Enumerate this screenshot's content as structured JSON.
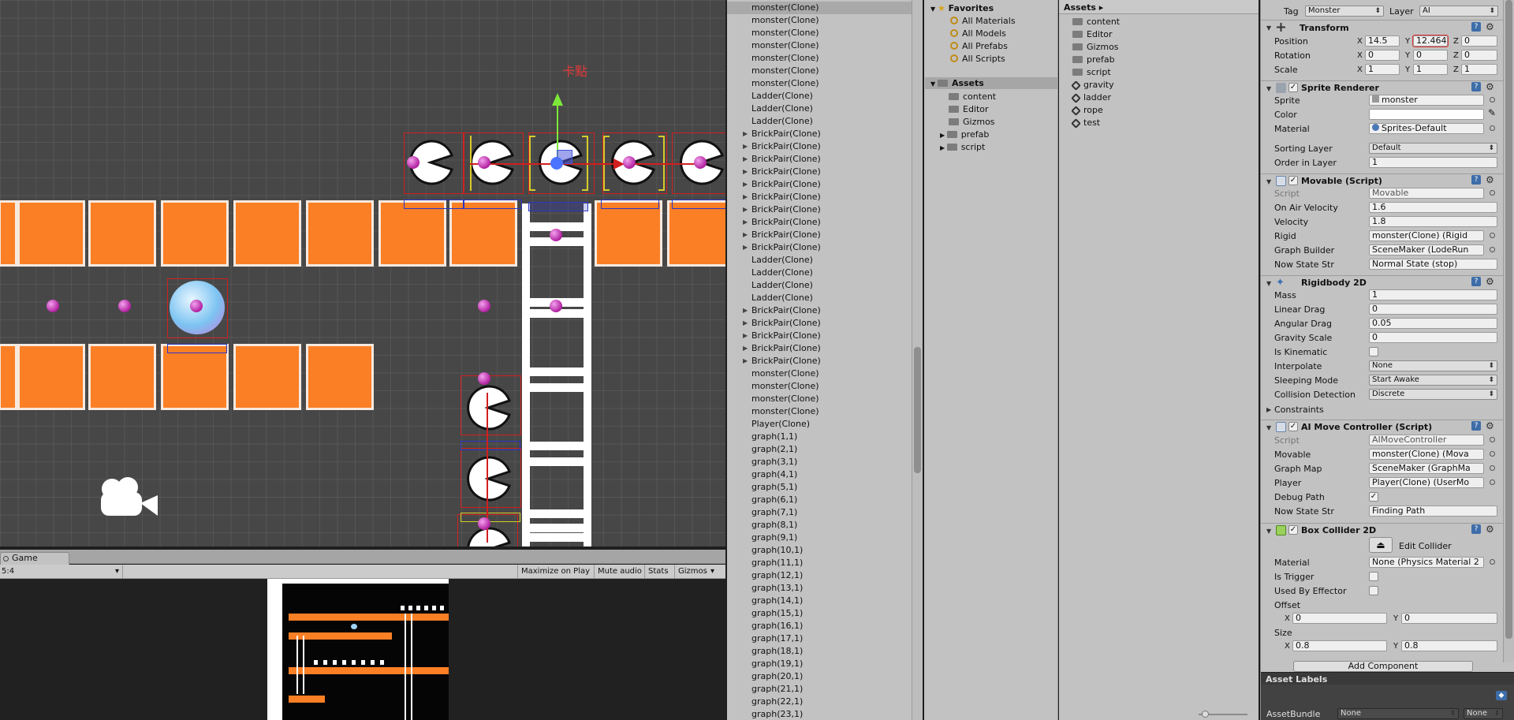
{
  "scene": {
    "label": "卡點"
  },
  "game": {
    "tab": "Game",
    "aspect": "5:4",
    "buttons": [
      "Maximize on Play",
      "Mute audio",
      "Stats",
      "Gizmos"
    ]
  },
  "hierarchy": {
    "items": [
      {
        "label": "monster(Clone)",
        "expandable": false,
        "selected": true
      },
      {
        "label": "monster(Clone)",
        "expandable": false
      },
      {
        "label": "monster(Clone)",
        "expandable": false
      },
      {
        "label": "monster(Clone)",
        "expandable": false
      },
      {
        "label": "monster(Clone)",
        "expandable": false
      },
      {
        "label": "monster(Clone)",
        "expandable": false
      },
      {
        "label": "monster(Clone)",
        "expandable": false
      },
      {
        "label": "Ladder(Clone)",
        "expandable": false
      },
      {
        "label": "Ladder(Clone)",
        "expandable": false
      },
      {
        "label": "Ladder(Clone)",
        "expandable": false
      },
      {
        "label": "BrickPair(Clone)",
        "expandable": true
      },
      {
        "label": "BrickPair(Clone)",
        "expandable": true
      },
      {
        "label": "BrickPair(Clone)",
        "expandable": true
      },
      {
        "label": "BrickPair(Clone)",
        "expandable": true
      },
      {
        "label": "BrickPair(Clone)",
        "expandable": true
      },
      {
        "label": "BrickPair(Clone)",
        "expandable": true
      },
      {
        "label": "BrickPair(Clone)",
        "expandable": true
      },
      {
        "label": "BrickPair(Clone)",
        "expandable": true
      },
      {
        "label": "BrickPair(Clone)",
        "expandable": true
      },
      {
        "label": "BrickPair(Clone)",
        "expandable": true
      },
      {
        "label": "Ladder(Clone)",
        "expandable": false
      },
      {
        "label": "Ladder(Clone)",
        "expandable": false
      },
      {
        "label": "Ladder(Clone)",
        "expandable": false
      },
      {
        "label": "Ladder(Clone)",
        "expandable": false
      },
      {
        "label": "BrickPair(Clone)",
        "expandable": true
      },
      {
        "label": "BrickPair(Clone)",
        "expandable": true
      },
      {
        "label": "BrickPair(Clone)",
        "expandable": true
      },
      {
        "label": "BrickPair(Clone)",
        "expandable": true
      },
      {
        "label": "BrickPair(Clone)",
        "expandable": true
      },
      {
        "label": "monster(Clone)",
        "expandable": false
      },
      {
        "label": "monster(Clone)",
        "expandable": false
      },
      {
        "label": "monster(Clone)",
        "expandable": false
      },
      {
        "label": "monster(Clone)",
        "expandable": false
      },
      {
        "label": "Player(Clone)",
        "expandable": false
      },
      {
        "label": "graph(1,1)",
        "expandable": false
      },
      {
        "label": "graph(2,1)",
        "expandable": false
      },
      {
        "label": "graph(3,1)",
        "expandable": false
      },
      {
        "label": "graph(4,1)",
        "expandable": false
      },
      {
        "label": "graph(5,1)",
        "expandable": false
      },
      {
        "label": "graph(6,1)",
        "expandable": false
      },
      {
        "label": "graph(7,1)",
        "expandable": false
      },
      {
        "label": "graph(8,1)",
        "expandable": false
      },
      {
        "label": "graph(9,1)",
        "expandable": false
      },
      {
        "label": "graph(10,1)",
        "expandable": false
      },
      {
        "label": "graph(11,1)",
        "expandable": false
      },
      {
        "label": "graph(12,1)",
        "expandable": false
      },
      {
        "label": "graph(13,1)",
        "expandable": false
      },
      {
        "label": "graph(14,1)",
        "expandable": false
      },
      {
        "label": "graph(15,1)",
        "expandable": false
      },
      {
        "label": "graph(16,1)",
        "expandable": false
      },
      {
        "label": "graph(17,1)",
        "expandable": false
      },
      {
        "label": "graph(18,1)",
        "expandable": false
      },
      {
        "label": "graph(19,1)",
        "expandable": false
      },
      {
        "label": "graph(20,1)",
        "expandable": false
      },
      {
        "label": "graph(21,1)",
        "expandable": false
      },
      {
        "label": "graph(22,1)",
        "expandable": false
      },
      {
        "label": "graph(23,1)",
        "expandable": false
      }
    ]
  },
  "project": {
    "favorites_label": "Favorites",
    "favorites": [
      "All Materials",
      "All Models",
      "All Prefabs",
      "All Scripts"
    ],
    "assets_label": "Assets",
    "asset_folders": [
      "content",
      "Editor",
      "Gizmos",
      "prefab",
      "script"
    ],
    "breadcrumb": "Assets ▸",
    "right_items": [
      {
        "label": "content",
        "kind": "folder"
      },
      {
        "label": "Editor",
        "kind": "folder"
      },
      {
        "label": "Gizmos",
        "kind": "folder"
      },
      {
        "label": "prefab",
        "kind": "folder"
      },
      {
        "label": "script",
        "kind": "folder"
      },
      {
        "label": "gravity",
        "kind": "scene"
      },
      {
        "label": "ladder",
        "kind": "scene"
      },
      {
        "label": "rope",
        "kind": "scene"
      },
      {
        "label": "test",
        "kind": "scene"
      }
    ]
  },
  "inspector": {
    "tag_label": "Tag",
    "tag_value": "Monster",
    "layer_label": "Layer",
    "layer_value": "AI",
    "transform": {
      "title": "Transform",
      "position_label": "Position",
      "rotation_label": "Rotation",
      "scale_label": "Scale",
      "position": {
        "x": "14.5",
        "y": "12.464",
        "z": "0"
      },
      "rotation": {
        "x": "0",
        "y": "0",
        "z": "0"
      },
      "scale": {
        "x": "1",
        "y": "1",
        "z": "1"
      }
    },
    "sprite_renderer": {
      "title": "Sprite Renderer",
      "sprite_label": "Sprite",
      "sprite": "monster",
      "color_label": "Color",
      "material_label": "Material",
      "material": "Sprites-Default",
      "sorting_layer_label": "Sorting Layer",
      "sorting_layer": "Default",
      "order_label": "Order in Layer",
      "order": "1"
    },
    "movable": {
      "title": "Movable (Script)",
      "script_label": "Script",
      "script": "Movable",
      "on_air_label": "On Air Velocity",
      "on_air": "1.6",
      "velocity_label": "Velocity",
      "velocity": "1.8",
      "rigid_label": "Rigid",
      "rigid": "monster(Clone) (Rigid",
      "graph_builder_label": "Graph Builder",
      "graph_builder": "SceneMaker (LodeRun",
      "state_label": "Now State Str",
      "state": "Normal State (stop)"
    },
    "rigidbody": {
      "title": "Rigidbody 2D",
      "mass_label": "Mass",
      "mass": "1",
      "linear_drag_label": "Linear Drag",
      "linear_drag": "0",
      "angular_drag_label": "Angular Drag",
      "angular_drag": "0.05",
      "gravity_label": "Gravity Scale",
      "gravity": "0",
      "kinematic_label": "Is Kinematic",
      "interpolate_label": "Interpolate",
      "interpolate": "None",
      "sleeping_label": "Sleeping Mode",
      "sleeping": "Start Awake",
      "collision_label": "Collision Detection",
      "collision": "Discrete",
      "constraints_label": "Constraints"
    },
    "ai_move": {
      "title": "AI Move Controller (Script)",
      "script_label": "Script",
      "script": "AIMoveController",
      "movable_label": "Movable",
      "movable": "monster(Clone) (Mova",
      "graph_map_label": "Graph Map",
      "graph_map": "SceneMaker (GraphMa",
      "player_label": "Player",
      "player": "Player(Clone) (UserMo",
      "debug_label": "Debug Path",
      "state_label": "Now State Str",
      "state": "Finding Path"
    },
    "box_collider": {
      "title": "Box Collider 2D",
      "edit_label": "Edit Collider",
      "material_label": "Material",
      "material": "None (Physics Material 2",
      "trigger_label": "Is Trigger",
      "effector_label": "Used By Effector",
      "offset_label": "Offset",
      "offset": {
        "x": "0",
        "y": "0"
      },
      "size_label": "Size",
      "size": {
        "x": "0.8",
        "y": "0.8"
      }
    },
    "add_component": "Add Component",
    "asset_labels": "Asset Labels",
    "assetbundle_label": "AssetBundle",
    "assetbundle_value": "None",
    "assetbundle_variant": "None"
  },
  "colors": {
    "brick": "#fb7f25",
    "selection": "#d21f1f",
    "collider": "#2a36c8",
    "gizmo_y": "#7ee83a",
    "dot": "#c22db4"
  }
}
